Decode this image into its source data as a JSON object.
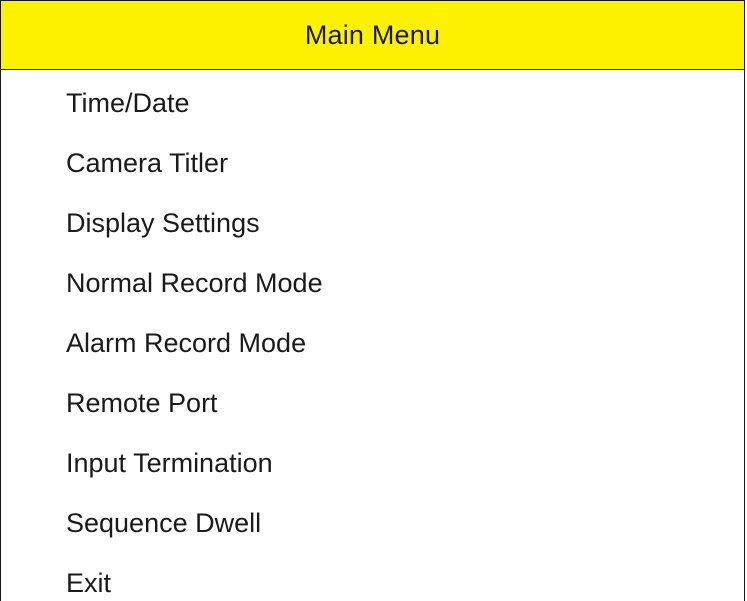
{
  "menu": {
    "title": "Main Menu",
    "header_color": "#fff200",
    "items": [
      {
        "label": "Time/Date"
      },
      {
        "label": "Camera Titler"
      },
      {
        "label": "Display Settings"
      },
      {
        "label": "Normal Record Mode"
      },
      {
        "label": "Alarm Record Mode"
      },
      {
        "label": "Remote Port"
      },
      {
        "label": "Input Termination"
      },
      {
        "label": "Sequence Dwell"
      },
      {
        "label": "Exit"
      }
    ]
  }
}
